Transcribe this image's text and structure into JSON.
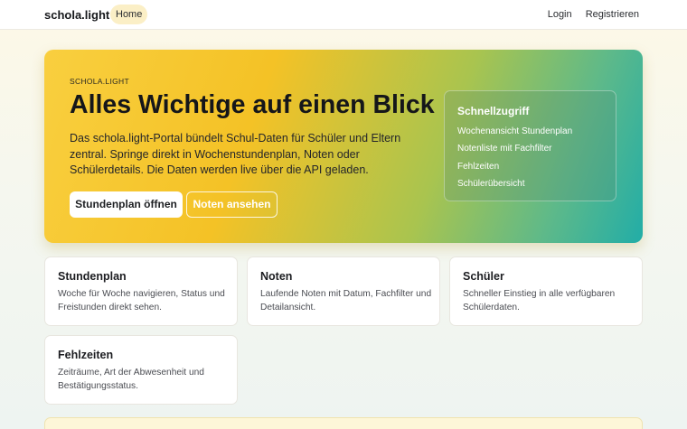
{
  "nav": {
    "brand": "schola.light",
    "home": "Home",
    "login": "Login",
    "register": "Registrieren"
  },
  "hero": {
    "eyebrow": "SCHOLA.LIGHT",
    "title": "Alles Wichtige auf einen Blick",
    "description": "Das schola.light-Portal bündelt Schul-Daten für Schüler und Eltern zentral. Springe direkt in Wochenstundenplan, Noten oder Schülerdetails. Die Daten werden live über die API geladen.",
    "primary_button": "Stundenplan öffnen",
    "secondary_button": "Noten ansehen",
    "quick_access": {
      "title": "Schnellzugriff",
      "items": [
        "Wochenansicht Stundenplan",
        "Notenliste mit Fachfilter",
        "Fehlzeiten",
        "Schülerübersicht"
      ]
    }
  },
  "cards": [
    {
      "title": "Stundenplan",
      "description": "Woche für Woche navigieren, Status und Freistunden direkt sehen."
    },
    {
      "title": "Noten",
      "description": "Laufende Noten mit Datum, Fachfilter und Detailansicht."
    },
    {
      "title": "Schüler",
      "description": "Schneller Einstieg in alle verfügbaren Schülerdaten."
    },
    {
      "title": "Fehlzeiten",
      "description": "Zeiträume, Art der Abwesenheit und Bestätigungsstatus."
    }
  ],
  "colors": {
    "hero_gradient_start": "#f9cf3f",
    "hero_gradient_end": "#22ada7",
    "nav_active_bg": "#fbefc6"
  }
}
